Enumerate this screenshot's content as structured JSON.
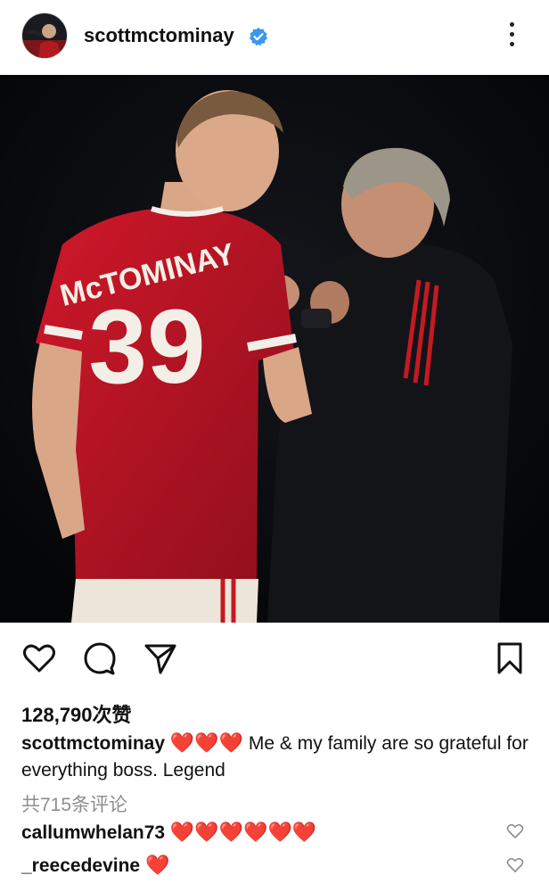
{
  "post": {
    "username": "scottmctominay",
    "likes": "128,790次赞",
    "caption_user": "scottmctominay",
    "caption_emoji": "❤️❤️❤️",
    "caption_text": "Me & my family are so grateful for everything boss. Legend",
    "view_comments": "共715条评论"
  },
  "photo": {
    "jersey_name": "McTOMINAY",
    "jersey_number": "39"
  },
  "comments": [
    {
      "user": "callumwhelan73",
      "text": "❤️❤️❤️❤️❤️❤️"
    },
    {
      "user": "_reecedevine",
      "text": "❤️"
    }
  ],
  "icons": {
    "like": "heart-outline-icon",
    "comment": "comment-bubble-icon",
    "share": "paper-plane-icon",
    "save": "bookmark-icon",
    "verified": "verified-badge-icon",
    "more": "more-vertical-icon"
  },
  "colors": {
    "verified_blue": "#3897f0",
    "heart_red": "#e0162b",
    "muted": "#8e8e8e"
  }
}
